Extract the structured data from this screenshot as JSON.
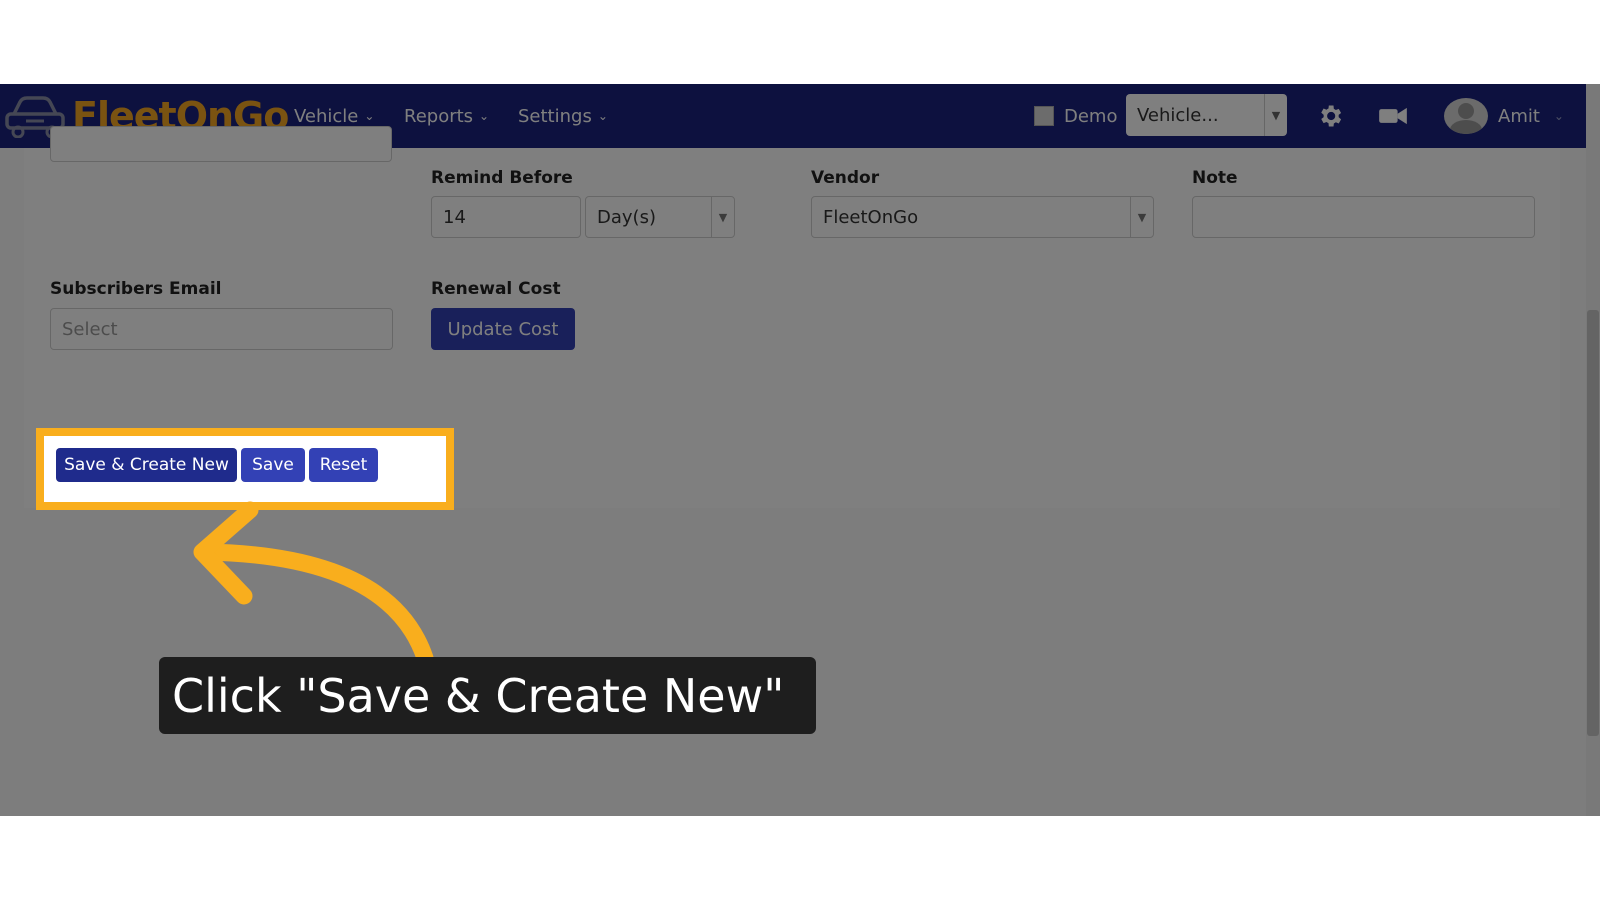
{
  "navbar": {
    "logo_text": "FleetOnGo",
    "menu": [
      {
        "label": "Vehicle"
      },
      {
        "label": "Reports"
      },
      {
        "label": "Settings"
      }
    ],
    "demo_label": "Demo",
    "vehicle_select": "Vehicle...",
    "user_name": "Amit"
  },
  "form": {
    "remind_before_label": "Remind Before",
    "remind_before_value": "14",
    "remind_unit": "Day(s)",
    "vendor_label": "Vendor",
    "vendor_value": "FleetOnGo",
    "note_label": "Note",
    "note_value": "",
    "subscribers_label": "Subscribers Email",
    "subscribers_placeholder": "Select",
    "renewal_cost_label": "Renewal Cost",
    "update_cost_label": "Update Cost"
  },
  "actions": {
    "save_create_new": "Save & Create New",
    "save": "Save",
    "reset": "Reset"
  },
  "callout": {
    "text": "Click \"Save & Create New\""
  },
  "colors": {
    "navbar": "#1a237e",
    "logo": "#f5a623",
    "highlight": "#f9ae1d",
    "primary_button": "#1f2b8c",
    "secondary_button": "#3341b5",
    "callout_bg": "#1e1e1e"
  }
}
